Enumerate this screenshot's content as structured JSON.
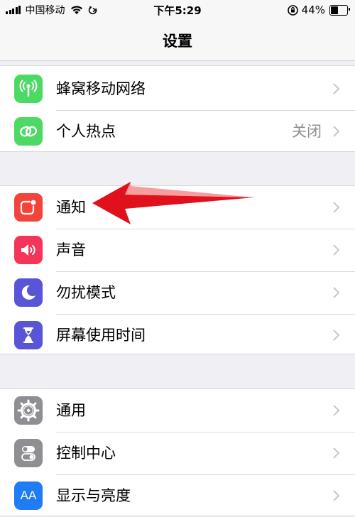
{
  "status_bar": {
    "carrier": "中国移动",
    "time": "下午5:29",
    "battery_percent": "44%",
    "battery_level": 0.44
  },
  "nav": {
    "title": "设置"
  },
  "groups": [
    {
      "items": [
        {
          "label": "蜂窝移动网络",
          "icon": "cellular-antenna-icon",
          "icon_color": "#4cd964"
        },
        {
          "label": "个人热点",
          "value": "关闭",
          "icon": "personal-hotspot-icon",
          "icon_color": "#4cd964"
        }
      ]
    },
    {
      "items": [
        {
          "label": "通知",
          "icon": "notifications-icon",
          "icon_color": "#f2443a"
        },
        {
          "label": "声音",
          "icon": "speaker-icon",
          "icon_color": "#f5345a"
        },
        {
          "label": "勿扰模式",
          "icon": "moon-icon",
          "icon_color": "#5856d6"
        },
        {
          "label": "屏幕使用时间",
          "icon": "hourglass-icon",
          "icon_color": "#5856d6"
        }
      ]
    },
    {
      "items": [
        {
          "label": "通用",
          "icon": "gear-icon",
          "icon_color": "#8e8e93"
        },
        {
          "label": "控制中心",
          "icon": "control-center-icon",
          "icon_color": "#8e8e93"
        },
        {
          "label": "显示与亮度",
          "icon": "display-brightness-icon",
          "icon_color": "#1f7cf5",
          "icon_text": "AA"
        }
      ]
    }
  ],
  "annotation": {
    "type": "red-arrow-pointing-left",
    "color": "#e0101c",
    "target": "通知"
  }
}
